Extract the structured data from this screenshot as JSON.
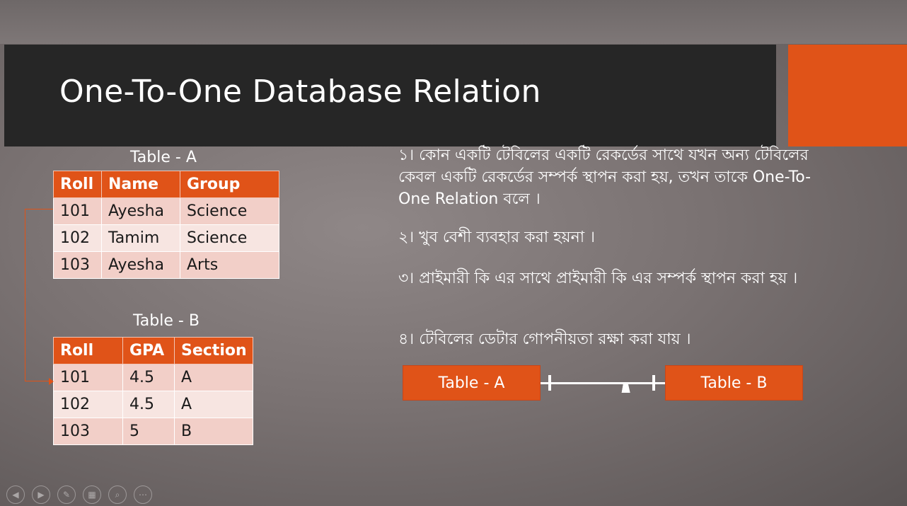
{
  "slide": {
    "title": "One-To-One Database Relation",
    "table_a": {
      "caption": "Table - A",
      "headers": [
        "Roll",
        "Name",
        "Group"
      ],
      "rows": [
        [
          "101",
          "Ayesha",
          "Science"
        ],
        [
          "102",
          "Tamim",
          "Science"
        ],
        [
          "103",
          "Ayesha",
          "Arts"
        ]
      ]
    },
    "table_b": {
      "caption": "Table - B",
      "headers": [
        "Roll",
        "GPA",
        "Section"
      ],
      "rows": [
        [
          "101",
          "4.5",
          "A"
        ],
        [
          "102",
          "4.5",
          "A"
        ],
        [
          "103",
          "5",
          "B"
        ]
      ]
    },
    "bullets": [
      "১। কোন একটি টেবিলের একটি রেকর্ডের সাথে যখন অন্য টেবিলের কেবল একটি রেকর্ডের সম্পর্ক স্থাপন করা হয়, তখন তাকে One-To-One Relation বলে ।",
      "২। খুব বেশী ব্যবহার করা হয়না ।",
      "৩। প্রাইমারী কি এর সাথে প্রাইমারী কি এর সম্পর্ক স্থাপন করা হয় ।",
      "৪। টেবিলের ডেটার গোপনীয়তা রক্ষা করা যায় ।"
    ],
    "diagram": {
      "left_box": "Table - A",
      "right_box": "Table - B"
    }
  },
  "colors": {
    "accent": "#e05318",
    "title_bar": "#262626",
    "row_light": "#f7e5e1",
    "row_dark": "#f2cfc8"
  },
  "controls": {
    "icons": [
      "previous-icon",
      "next-icon",
      "pen-icon",
      "slides-grid-icon",
      "zoom-icon",
      "more-icon"
    ]
  }
}
